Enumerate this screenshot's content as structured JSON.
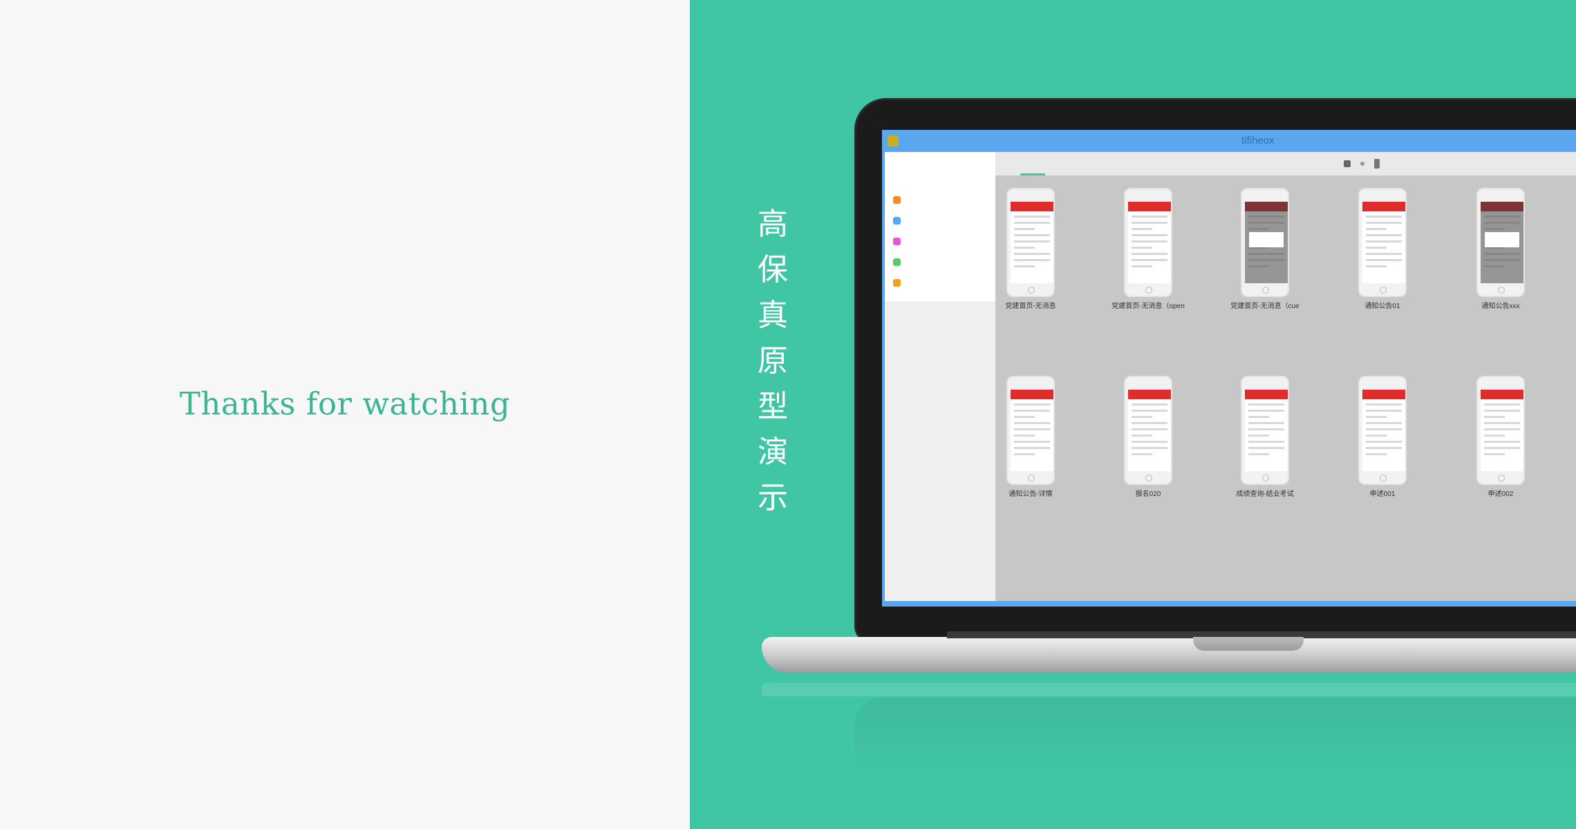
{
  "left": {
    "thanks": "Thanks for watching"
  },
  "right": {
    "vertical_title": [
      "高",
      "保",
      "真",
      "原",
      "型",
      "演",
      "示"
    ]
  },
  "app": {
    "window_title": "tifiheox",
    "sidebar": {
      "head_title": "",
      "head_sub": "",
      "items": [
        {
          "label": "",
          "color": "#f08a2a"
        },
        {
          "label": "",
          "color": "#5aa7ef"
        },
        {
          "label": "",
          "color": "#e05ac8"
        },
        {
          "label": "",
          "color": "#5cc86a"
        },
        {
          "label": "",
          "color": "#f0a020"
        }
      ]
    },
    "tabs": [
      "",
      "",
      "",
      ""
    ],
    "screens_row1": [
      {
        "label": "党建首页-无消息",
        "variant": "plain"
      },
      {
        "label": "党建首页-无消息（open",
        "variant": "plain"
      },
      {
        "label": "党建首页-无消息（cue",
        "variant": "dark"
      },
      {
        "label": "通知公告01",
        "variant": "plain"
      },
      {
        "label": "通知公告xxx",
        "variant": "dark"
      }
    ],
    "screens_row2": [
      {
        "label": "通知公告-详情",
        "variant": "plain"
      },
      {
        "label": "报名020",
        "variant": "plain"
      },
      {
        "label": "成绩查询-结业考试",
        "variant": "plain"
      },
      {
        "label": "申述001",
        "variant": "plain"
      },
      {
        "label": "申述002",
        "variant": "plain"
      }
    ]
  }
}
